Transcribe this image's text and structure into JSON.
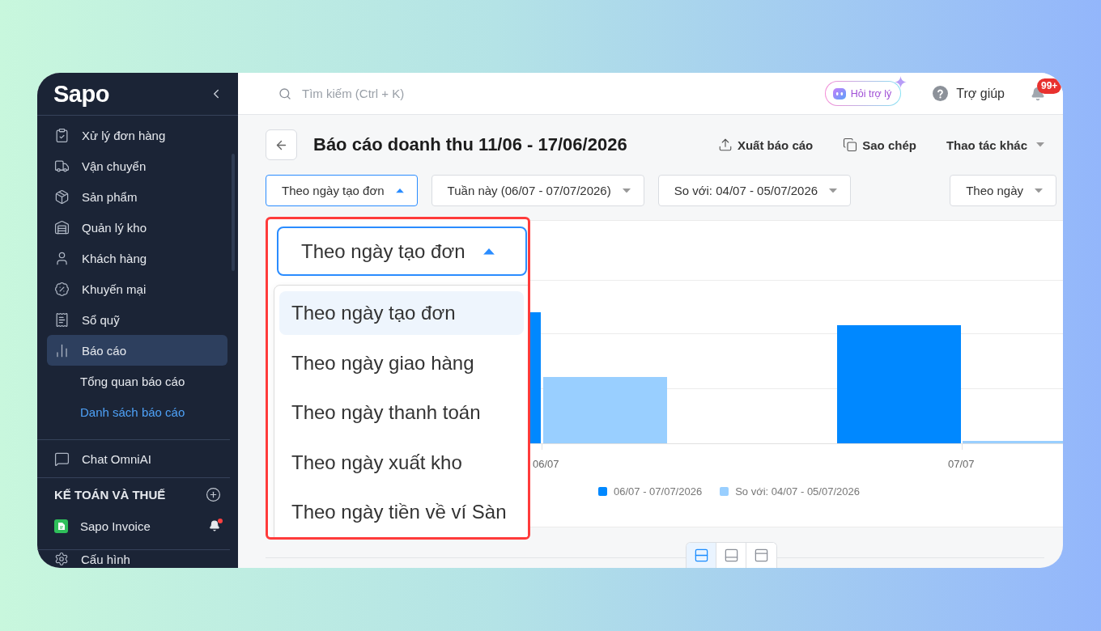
{
  "sidebar": {
    "logo": "Sapo",
    "menu": [
      {
        "label": "Xử lý đơn hàng",
        "selected": false
      },
      {
        "label": "Vận chuyển",
        "selected": false
      },
      {
        "label": "Sản phẩm",
        "selected": false
      },
      {
        "label": "Quản lý kho",
        "selected": false
      },
      {
        "label": "Khách hàng",
        "selected": false
      },
      {
        "label": "Khuyến mại",
        "selected": false
      },
      {
        "label": "Sổ quỹ",
        "selected": false
      },
      {
        "label": "Báo cáo",
        "selected": true,
        "children": [
          {
            "label": "Tổng quan báo cáo",
            "selected": false
          },
          {
            "label": "Danh sách báo cáo",
            "selected": true
          }
        ]
      }
    ],
    "apps": [
      {
        "label": "Chat OmniAI"
      }
    ],
    "section": {
      "title": "KẾ TOÁN VÀ THUẾ",
      "items": [
        {
          "label": "Sapo Invoice",
          "notification": true
        }
      ]
    },
    "footer": [
      {
        "label": "Cấu hình"
      }
    ]
  },
  "topbar": {
    "search": {
      "placeholder": "Tìm kiếm (Ctrl + K)"
    },
    "assistant": "Hỏi trợ lý",
    "help": "Trợ giúp",
    "notifications": {
      "badge": "99+"
    }
  },
  "header": {
    "title": "Báo cáo doanh thu 11/06 - 17/06/2026",
    "actions": [
      {
        "kind": "export",
        "label": "Xuất báo cáo"
      },
      {
        "kind": "copy",
        "label": "Sao chép"
      },
      {
        "kind": "more",
        "label": "Thao tác khác"
      }
    ]
  },
  "filters": [
    {
      "label": "Theo ngày tạo đơn",
      "expanded": true
    },
    {
      "label": "Tuần này (06/07 - 07/07/2026)",
      "expanded": false
    },
    {
      "label": "So với: 04/07 - 05/07/2026",
      "expanded": false
    },
    {
      "label": "Theo ngày",
      "expanded": false
    }
  ],
  "chart": {
    "x_labels": [
      "06/07",
      "07/07"
    ],
    "legend": [
      {
        "label": "06/07 - 07/07/2026",
        "color": "#0088ff"
      },
      {
        "label": "So với: 04/07 - 05/07/2026",
        "color": "#99cfff"
      }
    ]
  },
  "layout_toggle": [
    {
      "selected": true
    },
    {
      "selected": false
    },
    {
      "selected": false
    }
  ],
  "callout": {
    "select": {
      "label": "Theo ngày tạo đơn",
      "expanded": true
    },
    "options": [
      {
        "label": "Theo ngày tạo đơn",
        "selected": true
      },
      {
        "label": "Theo ngày giao hàng",
        "selected": false
      },
      {
        "label": "Theo ngày thanh toán",
        "selected": false
      },
      {
        "label": "Theo ngày xuất kho",
        "selected": false
      },
      {
        "label": "Theo ngày tiền về ví Sàn",
        "selected": false
      }
    ]
  }
}
